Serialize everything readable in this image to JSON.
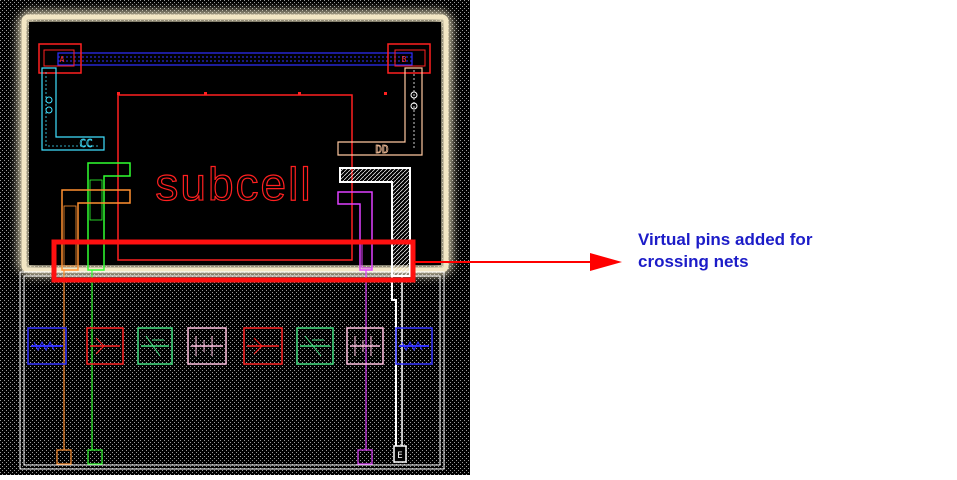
{
  "layout": {
    "cell_name": "subcell",
    "pins": [
      {
        "id": "A",
        "label": "A",
        "color": "#ff3030"
      },
      {
        "id": "B",
        "label": "B",
        "color": "#ff3030"
      },
      {
        "id": "CC",
        "label": "CC",
        "color": "#40e0ff"
      },
      {
        "id": "DD",
        "label": "DD",
        "color": "#ffd0b0"
      },
      {
        "id": "E",
        "label": "E",
        "color": "#ffffff"
      }
    ],
    "net_colors": {
      "blue": "#3030ff",
      "red": "#ff2020",
      "cyan": "#40e0ff",
      "peach": "#ffc8a0",
      "green": "#30ff30",
      "orange": "#ff9030",
      "magenta": "#e040ff",
      "white": "#ffffff",
      "pink": "#ffc0e0",
      "mint": "#40e080"
    }
  },
  "annotation": {
    "line1": "Virtual pins added for",
    "line2": "crossing nets",
    "color": "#1c1cc8",
    "arrow_color": "#ff0000"
  }
}
